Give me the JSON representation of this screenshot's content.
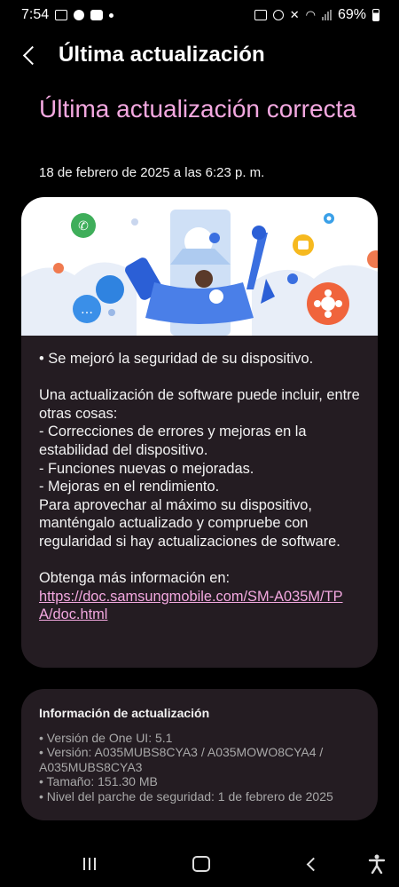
{
  "status_bar": {
    "time": "7:54",
    "battery": "69%"
  },
  "app_bar": {
    "title": "Última actualización"
  },
  "hero": {
    "title": "Última actualización correcta",
    "date": "18 de febrero de 2025 a las 6:23 p. m."
  },
  "notes": {
    "line1": "• Se mejoró la seguridad de su dispositivo.",
    "line2": "Una actualización de software puede incluir, entre otras cosas:",
    "line3": " - Correcciones de errores y mejoras en la estabilidad del dispositivo.",
    "line4": " - Funciones nuevas o mejoradas.",
    "line5": " - Mejoras en el rendimiento.",
    "line6": "Para aprovechar al máximo su dispositivo, manténgalo actualizado y compruebe con regularidad si hay actualizaciones de software.",
    "more_info": "Obtenga más información en:",
    "link": "https://doc.samsungmobile.com/SM-A035M/TPA/doc.html"
  },
  "info": {
    "title": "Información de actualización",
    "items": [
      "• Versión de One UI: 5.1",
      "• Versión: A035MUBS8CYA3 / A035MOWO8CYA4 / A035MUBS8CYA3",
      "• Tamaño: 151.30 MB",
      "• Nivel del parche de seguridad: 1 de febrero de 2025"
    ]
  },
  "colors": {
    "accent": "#f3a8e0",
    "card": "#241c22",
    "background": "#000000"
  }
}
